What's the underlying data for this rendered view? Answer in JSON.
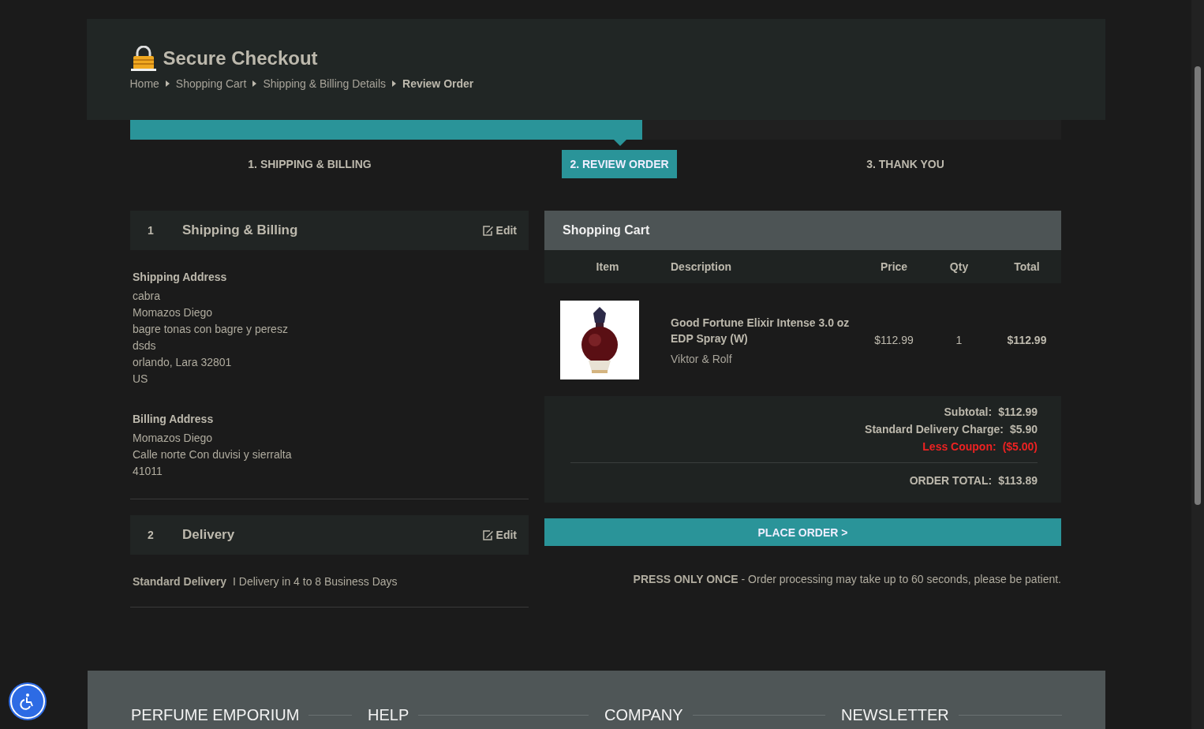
{
  "header": {
    "title": "Secure Checkout",
    "breadcrumbs": [
      {
        "label": "Home",
        "current": false
      },
      {
        "label": "Shopping Cart",
        "current": false
      },
      {
        "label": "Shipping & Billing Details",
        "current": false
      },
      {
        "label": "Review Order",
        "current": true
      }
    ]
  },
  "progress": {
    "level": 0.55
  },
  "steps": [
    {
      "label": "1. SHIPPING & BILLING",
      "selected": false
    },
    {
      "label": "2. REVIEW ORDER",
      "selected": true
    },
    {
      "label": "3. THANK YOU",
      "selected": false
    }
  ],
  "sections": [
    {
      "number": "1",
      "title": "Shipping & Billing",
      "edit": "Edit",
      "kind": "addresses",
      "blocks": [
        {
          "heading": "Shipping Address",
          "lines": [
            "cabra",
            "Momazos Diego",
            "bagre tonas con bagre y peresz",
            "dsds",
            "orlando, Lara 32801",
            "US"
          ]
        },
        {
          "heading": "Billing Address",
          "lines": [
            "Momazos Diego",
            "Calle norte Con duvisi y sierralta",
            "41011"
          ]
        }
      ]
    },
    {
      "number": "2",
      "title": "Delivery",
      "edit": "Edit",
      "kind": "delivery",
      "method": "Standard Delivery",
      "detail": "I Delivery in 4 to 8 Business Days"
    }
  ],
  "cart": {
    "title": "Shopping Cart",
    "columns": [
      "Item",
      "Description",
      "Price",
      "Qty",
      "Total"
    ],
    "rows": [
      {
        "name": "Good Fortune Elixir Intense 3.0 oz EDP Spray (W)",
        "brand": "Viktor & Rolf",
        "price": "$112.99",
        "qty": "1",
        "total": "$112.99"
      }
    ],
    "totals": [
      {
        "label": "Subtotal:",
        "value": "$112.99",
        "kind": "normal"
      },
      {
        "label": "Standard Delivery Charge:",
        "value": "$5.90",
        "kind": "normal"
      },
      {
        "label": "Less Coupon:",
        "value": "($5.00)",
        "kind": "discount"
      },
      {
        "label": "ORDER TOTAL:",
        "value": "$113.89",
        "kind": "grand"
      }
    ]
  },
  "place_order": {
    "button": "PLACE ORDER >",
    "note_bold": "PRESS ONLY ONCE",
    "note": "- Order processing may take up to 60 seconds, please be patient."
  },
  "footer": {
    "headings": [
      "PERFUME EMPORIUM",
      "HELP",
      "COMPANY",
      "NEWSLETTER"
    ]
  }
}
